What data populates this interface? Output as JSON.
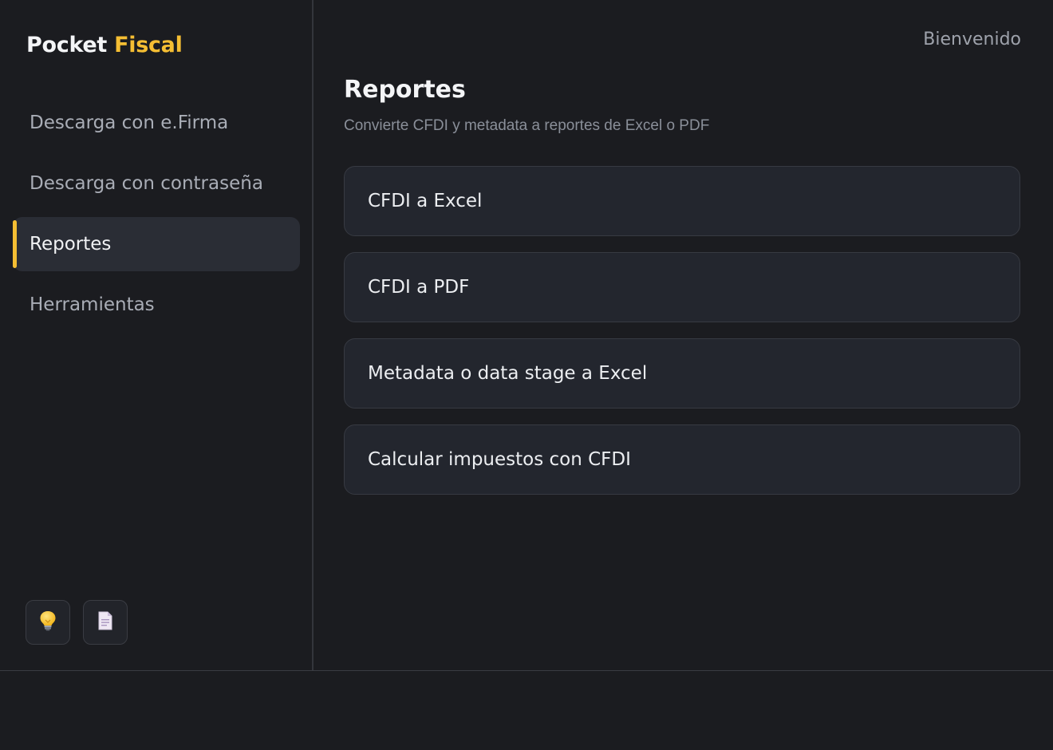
{
  "brand": {
    "name_part1": "Pocket",
    "name_part2": "Fiscal"
  },
  "sidebar": {
    "items": [
      {
        "label": "Descarga con e.Firma",
        "active": false
      },
      {
        "label": "Descarga con contraseña",
        "active": false
      },
      {
        "label": "Reportes",
        "active": true
      },
      {
        "label": "Herramientas",
        "active": false
      }
    ],
    "bottom_icons": [
      {
        "icon": "lightbulb-icon"
      },
      {
        "icon": "document-icon"
      }
    ]
  },
  "header": {
    "welcome": "Bienvenido"
  },
  "main": {
    "title": "Reportes",
    "subtitle": "Convierte CFDI y metadata a reportes de Excel o PDF",
    "cards": [
      {
        "label": "CFDI a Excel"
      },
      {
        "label": "CFDI a PDF"
      },
      {
        "label": "Metadata o data stage a Excel"
      },
      {
        "label": "Calcular impuestos con CFDI"
      }
    ]
  },
  "colors": {
    "accent": "#f5be33",
    "background": "#1b1c20",
    "card": "#23262e",
    "active_nav": "#2a2d35"
  }
}
